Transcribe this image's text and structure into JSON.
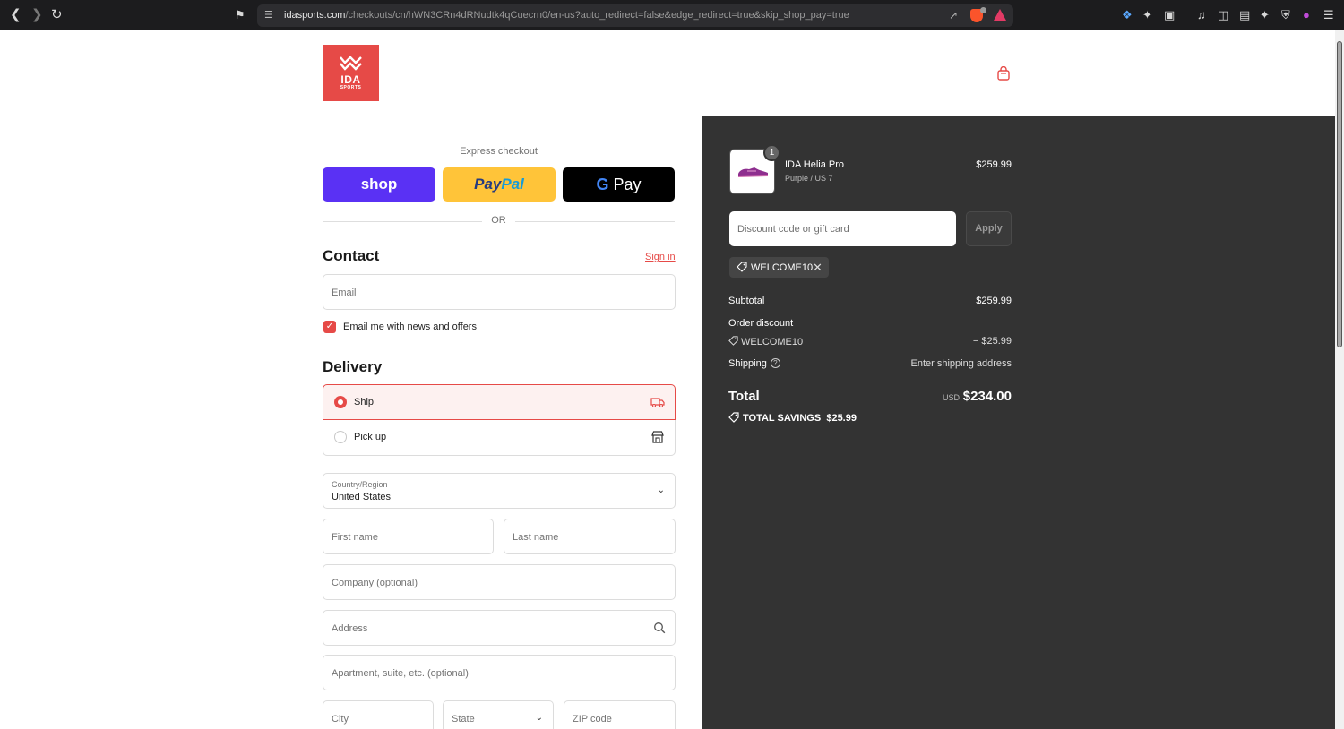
{
  "browser": {
    "url_host": "idasports.com",
    "url_path": "/checkouts/cn/hWN3CRn4dRNudtk4qCuecrn0/en-us?auto_redirect=false&edge_redirect=true&skip_shop_pay=true"
  },
  "logo": {
    "line1": "IDA",
    "line2": "SPORTS"
  },
  "express": {
    "label": "Express checkout",
    "shop_label": "shop",
    "paypal_label_a": "Pay",
    "paypal_label_b": "Pal",
    "gpay_label_g": "G",
    "gpay_label_pay": "Pay",
    "or_label": "OR"
  },
  "contact": {
    "title": "Contact",
    "signin_label": "Sign in",
    "email_placeholder": "Email",
    "newsletter_label": "Email me with news and offers",
    "newsletter_checked": true
  },
  "delivery": {
    "title": "Delivery",
    "options": [
      {
        "label": "Ship",
        "selected": true
      },
      {
        "label": "Pick up",
        "selected": false
      }
    ],
    "country_label": "Country/Region",
    "country_value": "United States",
    "first_name_placeholder": "First name",
    "last_name_placeholder": "Last name",
    "company_placeholder": "Company (optional)",
    "address_placeholder": "Address",
    "apartment_placeholder": "Apartment, suite, etc. (optional)",
    "city_placeholder": "City",
    "state_placeholder": "State",
    "zip_placeholder": "ZIP code"
  },
  "summary": {
    "product": {
      "name": "IDA Helia Pro",
      "variant": "Purple / US 7",
      "price": "$259.99",
      "quantity": "1"
    },
    "discount_placeholder": "Discount code or gift card",
    "apply_label": "Apply",
    "applied_code": "WELCOME10",
    "subtotal_label": "Subtotal",
    "subtotal_value": "$259.99",
    "order_discount_label": "Order discount",
    "order_discount_code": "WELCOME10",
    "order_discount_value": "− $25.99",
    "shipping_label": "Shipping",
    "shipping_value": "Enter shipping address",
    "total_label": "Total",
    "currency": "USD",
    "total_value": "$234.00",
    "savings_label": "TOTAL SAVINGS",
    "savings_value": "$25.99"
  },
  "colors": {
    "accent": "#e64a47",
    "summary_bg": "#333333",
    "shop_pay": "#5a31f4",
    "paypal": "#ffc439"
  }
}
